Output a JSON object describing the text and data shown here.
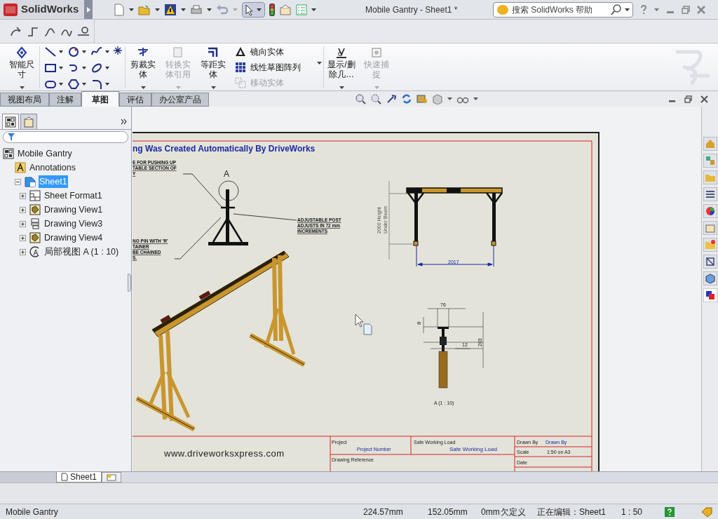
{
  "window": {
    "app_name": "SolidWorks",
    "title": "Mobile Gantry - Sheet1 *",
    "search_placeholder": "搜索 SolidWorks 帮助"
  },
  "ribbon": [
    {
      "kind": "large",
      "label": "智能尺寸",
      "disabled": false
    },
    {
      "kind": "large",
      "label": "剪裁实体",
      "disabled": false
    },
    {
      "kind": "large",
      "label": "转换实体引用",
      "disabled": true
    },
    {
      "kind": "large",
      "label": "等距实体",
      "disabled": false
    },
    {
      "kind": "small",
      "label": "镜向实体",
      "disabled": false
    },
    {
      "kind": "small",
      "label": "线性草图阵列",
      "disabled": false
    },
    {
      "kind": "small",
      "label": "移动实体",
      "disabled": true
    },
    {
      "kind": "large",
      "label": "显示/删除几…",
      "disabled": false
    },
    {
      "kind": "large",
      "label": "快速捕捉",
      "disabled": true
    }
  ],
  "tabs": [
    {
      "label": "视图布局",
      "selected": false
    },
    {
      "label": "注解",
      "selected": false
    },
    {
      "label": "草图",
      "selected": true
    },
    {
      "label": "评估",
      "selected": false
    },
    {
      "label": "办公室产品",
      "selected": false
    }
  ],
  "tree": [
    {
      "kind": "drawing",
      "label": "Mobile Gantry",
      "selected": false,
      "children": [
        {
          "kind": "annotations",
          "label": "Annotations",
          "selected": false
        },
        {
          "kind": "sheet",
          "label": "Sheet1",
          "selected": true,
          "expanded": true,
          "children": [
            {
              "kind": "sheet_format",
              "label": "Sheet Format1",
              "selected": false,
              "expanded": false
            },
            {
              "kind": "view",
              "label": "Drawing View1",
              "selected": false,
              "expanded": false
            },
            {
              "kind": "view_alt",
              "label": "Drawing View3",
              "selected": false,
              "expanded": false
            },
            {
              "kind": "view",
              "label": "Drawing View4",
              "selected": false,
              "expanded": false
            },
            {
              "kind": "detail_view",
              "label": "局部视图 A (1 : 10)",
              "selected": false,
              "expanded": false
            }
          ]
        }
      ]
    }
  ],
  "drawing": {
    "heading": "ng Was Created Automatically By DriveWorks",
    "callouts": [
      [
        "E FOR PUSHING UP",
        "TABLE SECTION OF",
        "Y"
      ],
      [
        "NG PIN WITH 'R'",
        "TAINER",
        "BE CHAINED",
        "S."
      ],
      [
        "ADJUSTABLE POST",
        "ADJUSTS IN 72 mm",
        "INCREMENTS"
      ]
    ],
    "detail_marker": "A",
    "front_view": {
      "height_dim": [
        "2000 Height",
        "Under Beam"
      ],
      "width_dim": "2017"
    },
    "detail_view": {
      "dims": [
        "76",
        "8",
        "12",
        "203"
      ],
      "label": "A (1 : 10)"
    },
    "title_block": {
      "website": "www.driveworksxpress.com",
      "project_label": "Project",
      "project_value": "Project Number",
      "load_label": "Safe Working Load",
      "load_value": "Safe Working Load",
      "reference_label": "Drawing Reference",
      "drawn_by_label": "Drawn By",
      "drawn_by_value": "Drawn By",
      "scale_label": "Scale",
      "scale_value": "1:50 on A3",
      "date_label": "Date"
    }
  },
  "sheet_tabs": [
    {
      "label": "Sheet1",
      "selected": true
    }
  ],
  "status_bar": {
    "document": "Mobile Gantry",
    "x": "224.57mm",
    "y": "152.05mm",
    "z": "0mm",
    "state": "欠定义",
    "editing": "正在编辑：Sheet1",
    "scale": "1 : 50"
  }
}
